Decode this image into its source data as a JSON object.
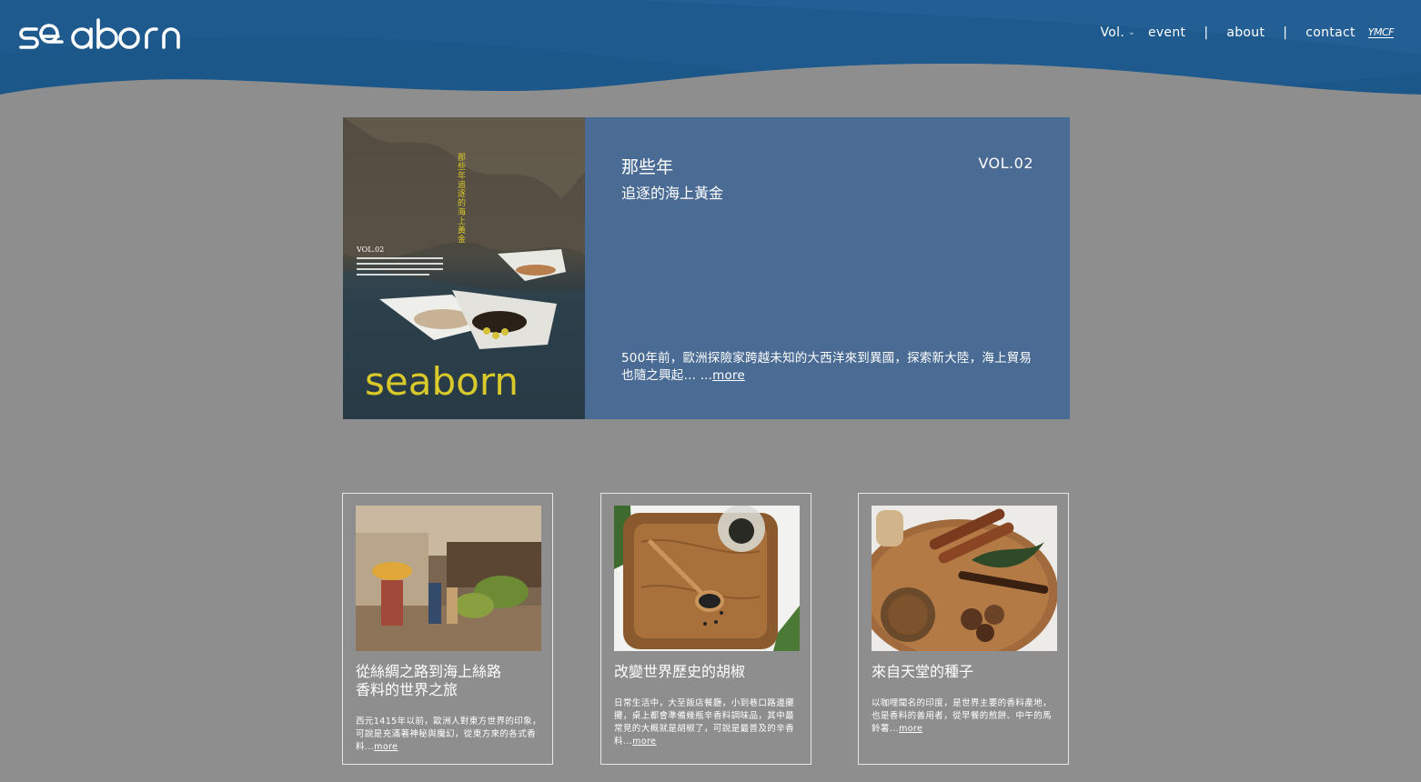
{
  "brand": {
    "name": "seaborn"
  },
  "nav": {
    "vol_label": "Vol.",
    "event_label": "event",
    "about_label": "about",
    "contact_label": "contact",
    "separator": "|",
    "partner_logo_text": "YMCF"
  },
  "hero": {
    "cover_brand": "seaborn",
    "cover_vol": "VOL.02",
    "cover_title": "那些年追逐的海上黃金",
    "title": "那些年",
    "subtitle": "追逐的海上黃金",
    "vol": "VOL.02",
    "excerpt": "500年前，歐洲探險家跨越未知的大西洋來到異國，探索新大陸，海上貿易也隨之興起… ...",
    "more_label": "more"
  },
  "cards": [
    {
      "title_line1": "從絲綢之路到海上絲路",
      "title_line2": "香料的世界之旅",
      "excerpt": "西元1415年以前，歐洲人對東方世界的印象，可說是充滿著神秘與魔幻，從東方來的各式香料...",
      "more_label": "more"
    },
    {
      "title_line1": "改變世界歷史的胡椒",
      "title_line2": "",
      "excerpt": "日常生活中，大至飯店餐廳，小到巷口路邊攤攤，桌上都會準備幾瓶辛香料調味品，其中最常見的大概就是胡椒了，可說是最普及的辛香料...",
      "more_label": "more"
    },
    {
      "title_line1": "來自天堂的種子",
      "title_line2": "",
      "excerpt": "以咖哩聞名的印度，是世界主要的香料產地，也是香料的善用者，從早餐的煎餅、中午的馬鈴薯...",
      "more_label": "more"
    }
  ],
  "colors": {
    "header_blue": "#1e5a8e",
    "header_light": "#3b78aa",
    "hero_bg": "#4a6b94",
    "page_bg": "#8e8e8e",
    "cover_yellow": "#d9c92a"
  },
  "icons": [
    "chevron-down-icon"
  ]
}
